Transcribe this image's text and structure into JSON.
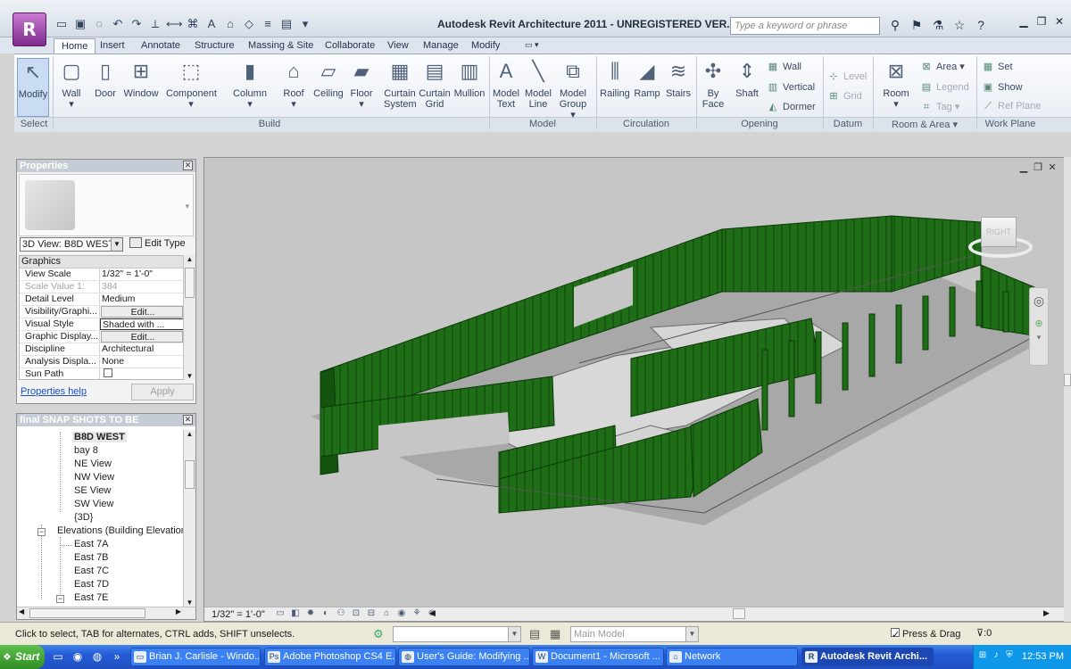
{
  "titlebar": {
    "app_logo": "R",
    "logo_sub": "A",
    "title": "Autodesk Revit Architecture 2011 - UNREGISTERED VER...",
    "search_placeholder": "Type a keyword or phrase"
  },
  "tabs": [
    "Home",
    "Insert",
    "Annotate",
    "Structure",
    "Massing & Site",
    "Collaborate",
    "View",
    "Manage",
    "Modify"
  ],
  "ribbon": {
    "modify": "Modify",
    "build": [
      "Wall",
      "Door",
      "Window",
      "Component",
      "Column",
      "Roof",
      "Ceiling",
      "Floor",
      "Curtain System",
      "Curtain Grid",
      "Mullion"
    ],
    "model": [
      "Model Text",
      "Model Line",
      "Model Group"
    ],
    "circulation": [
      "Railing",
      "Ramp",
      "Stairs"
    ],
    "opening_large": [
      "By Face",
      "Shaft"
    ],
    "opening_small": [
      "Wall",
      "Vertical",
      "Dormer"
    ],
    "datum": [
      "Level",
      "Grid"
    ],
    "room": "Room",
    "room_small": [
      "Area",
      "Legend",
      "Tag"
    ],
    "workplane": [
      "Set",
      "Show",
      "Ref Plane"
    ],
    "panels": [
      "Select",
      "Build",
      "Model",
      "Circulation",
      "Opening",
      "Datum",
      "Room & Area",
      "Work Plane"
    ]
  },
  "properties": {
    "title": "Properties",
    "type_selector": "3D View: B8D WEST",
    "edit_type": "Edit Type",
    "group": "Graphics",
    "rows": [
      {
        "k": "View Scale",
        "v": "1/32\" = 1'-0\""
      },
      {
        "k": "Scale Value    1:",
        "v": "384"
      },
      {
        "k": "Detail Level",
        "v": "Medium"
      },
      {
        "k": "Visibility/Graphi...",
        "v": "Edit..."
      },
      {
        "k": "Visual Style",
        "v": "Shaded with ..."
      },
      {
        "k": "Graphic Display...",
        "v": "Edit..."
      },
      {
        "k": "Discipline",
        "v": "Architectural"
      },
      {
        "k": "Analysis Displa...",
        "v": "None"
      },
      {
        "k": "Sun Path",
        "v": ""
      }
    ],
    "help": "Properties help",
    "apply": "Apply"
  },
  "browser": {
    "title": "final SNAP SHOTS TO BE RENDERED...",
    "items": [
      "B8D WEST",
      "bay 8",
      "NE View",
      "NW View",
      "SE View",
      "SW View",
      "{3D}",
      "Elevations (Building Elevation",
      "East 7A",
      "East 7B",
      "East 7C",
      "East 7D",
      "East 7E"
    ]
  },
  "viewport": {
    "scale": "1/32\" = 1'-0\"",
    "viewcube_label": "RIGHT"
  },
  "statusbar": {
    "hint": "Click to select, TAB for alternates, CTRL adds, SHIFT unselects.",
    "main_model": "Main Model",
    "press_drag": "Press & Drag",
    "filter": ":0"
  },
  "taskbar": {
    "start": "Start",
    "tasks": [
      "Brian J. Carlisle - Windo...",
      "Adobe Photoshop CS4 E...",
      "User's Guide: Modifying ...",
      "Document1 - Microsoft ...",
      "Network",
      "Autodesk Revit Archi..."
    ],
    "clock": "12:53 PM"
  },
  "colors": {
    "wall_green": "#1f6d16",
    "wall_green_dark": "#0f4a0a",
    "ground": "#c6c6c6",
    "taskbar_blue": "#245cd6"
  }
}
